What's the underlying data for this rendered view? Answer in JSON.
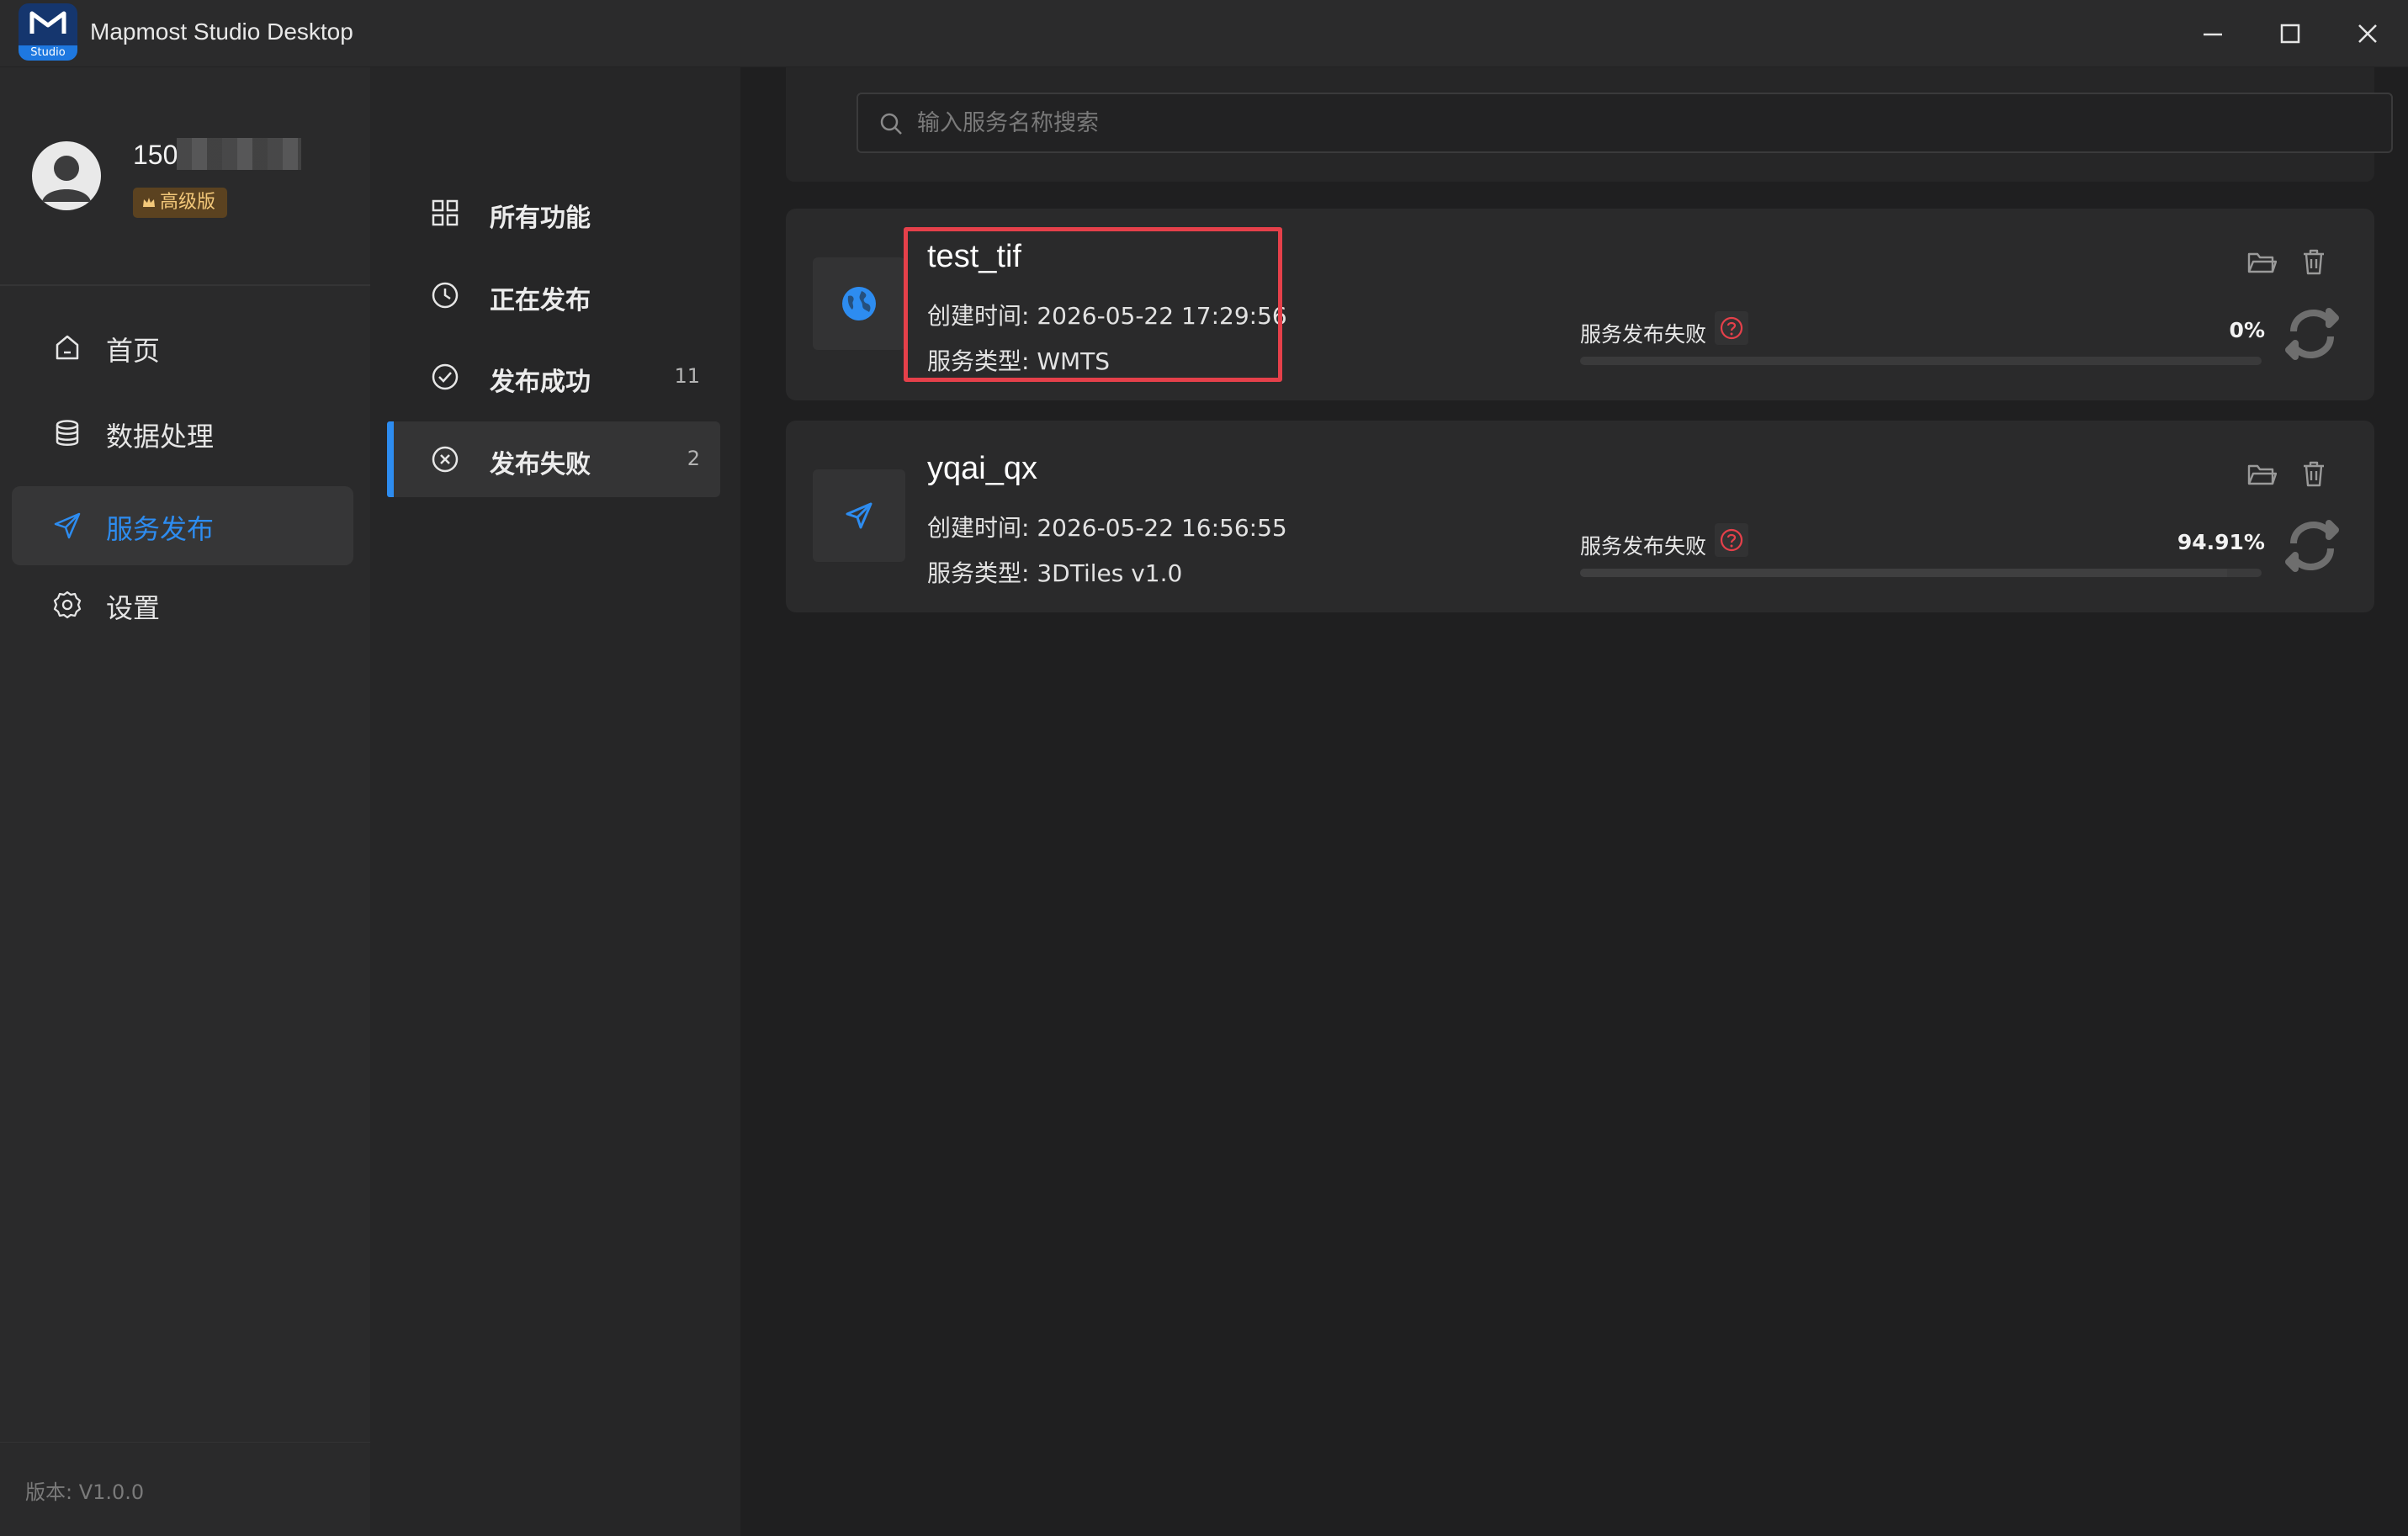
{
  "window": {
    "title": "Mapmost Studio Desktop",
    "logo_badge": "Studio"
  },
  "user": {
    "name": "150",
    "tier": "高级版"
  },
  "sidebar": {
    "items": [
      {
        "label": "首页",
        "icon": "home-icon"
      },
      {
        "label": "数据处理",
        "icon": "database-icon"
      },
      {
        "label": "服务发布",
        "icon": "send-icon",
        "active": true
      },
      {
        "label": "设置",
        "icon": "gear-icon"
      }
    ],
    "version": "版本: V1.0.0"
  },
  "subnav": {
    "items": [
      {
        "label": "所有功能",
        "icon": "grid-icon",
        "count": ""
      },
      {
        "label": "正在发布",
        "icon": "clock-icon",
        "count": ""
      },
      {
        "label": "发布成功",
        "icon": "check-circle-icon",
        "count": "11"
      },
      {
        "label": "发布失败",
        "icon": "x-circle-icon",
        "count": "2",
        "active": true
      }
    ]
  },
  "search": {
    "placeholder": "输入服务名称搜索"
  },
  "services": [
    {
      "name": "test_tif",
      "created": "创建时间: 2026-05-22 17:29:56",
      "type": "服务类型: WMTS",
      "status": "服务发布失败",
      "percent": "0%",
      "progress": 0,
      "icon": "globe-icon"
    },
    {
      "name": "yqai_qx",
      "created": "创建时间: 2026-05-22 16:56:55",
      "type": "服务类型: 3DTiles v1.0",
      "status": "服务发布失败",
      "percent": "94.91%",
      "progress": 94.91,
      "icon": "send-icon"
    }
  ],
  "colors": {
    "accent": "#2d8cf0",
    "error": "#e5404a",
    "badge_bg": "#5b4220",
    "badge_text": "#f3c87a"
  }
}
